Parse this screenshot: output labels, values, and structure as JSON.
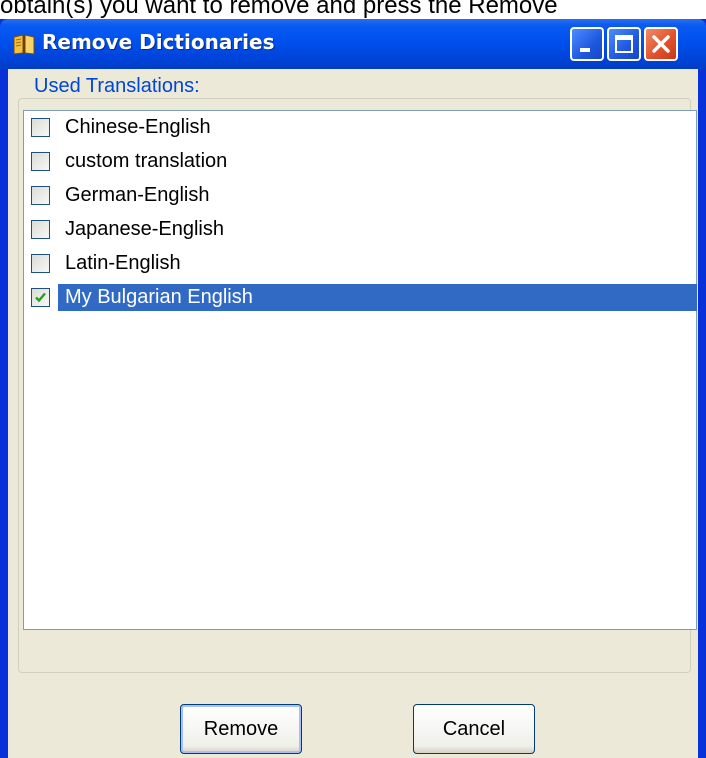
{
  "window": {
    "title": "Remove Dictionaries",
    "app_icon": "dictionary-book-icon",
    "controls": {
      "minimize": "minimize-icon",
      "maximize": "maximize-icon",
      "close": "close-icon"
    }
  },
  "group": {
    "legend": "Used Translations:"
  },
  "translations": [
    {
      "label": "Chinese-English",
      "checked": false,
      "selected": false
    },
    {
      "label": "custom translation",
      "checked": false,
      "selected": false
    },
    {
      "label": "German-English",
      "checked": false,
      "selected": false
    },
    {
      "label": "Japanese-English",
      "checked": false,
      "selected": false
    },
    {
      "label": "Latin-English",
      "checked": false,
      "selected": false
    },
    {
      "label": "My Bulgarian English",
      "checked": true,
      "selected": true
    }
  ],
  "buttons": {
    "remove": "Remove",
    "cancel": "Cancel"
  },
  "colors": {
    "selection": "#316ac5",
    "titlebar": "#0050ee",
    "legend": "#0046d5",
    "close": "#e2532c"
  }
}
